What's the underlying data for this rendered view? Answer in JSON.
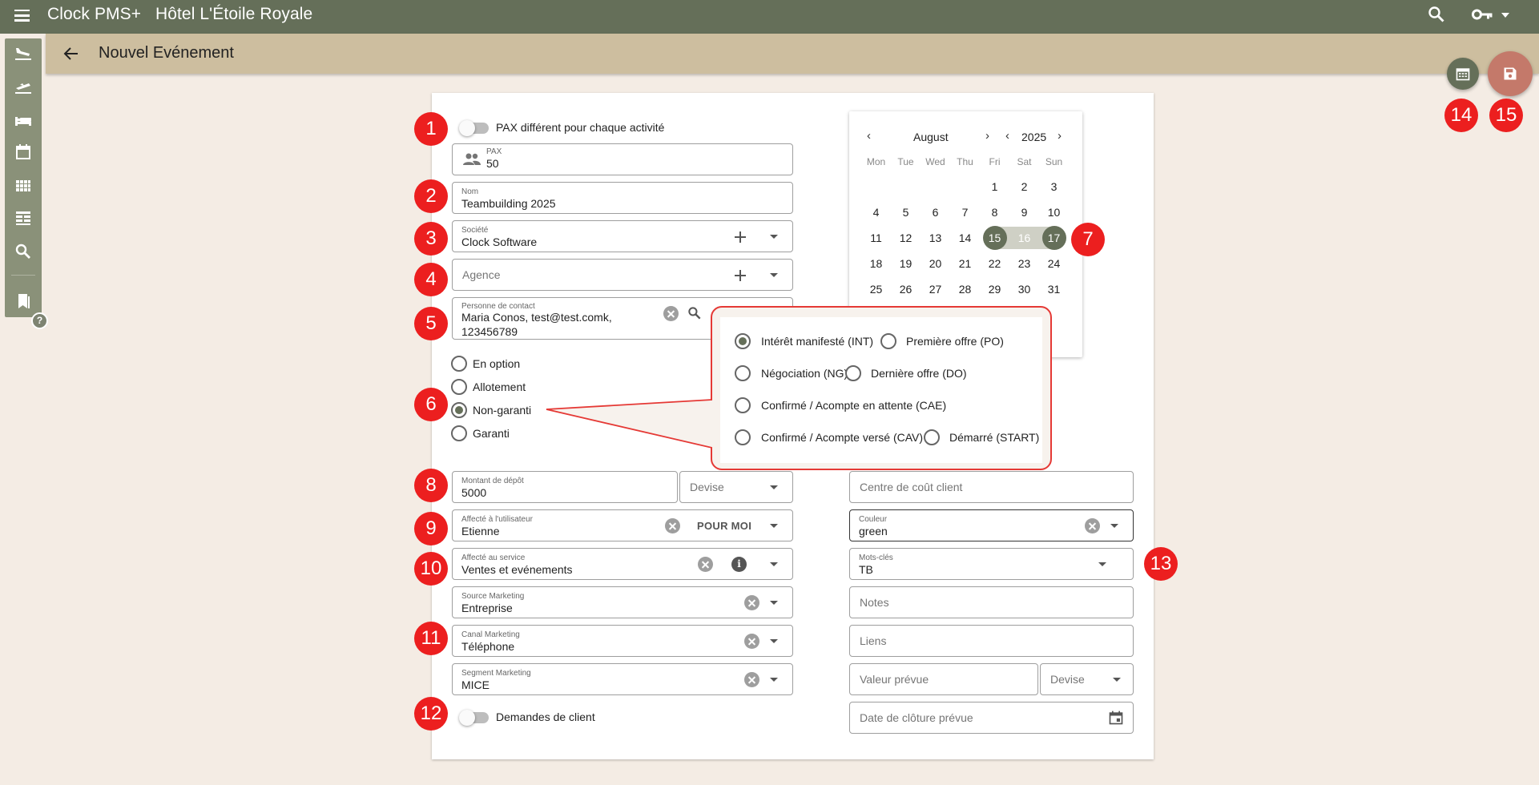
{
  "app": {
    "name": "Clock PMS+",
    "hotel": "Hôtel L'Étoile Royale"
  },
  "page": {
    "title": "Nouvel Evénement"
  },
  "toggles": {
    "pax_diff": "PAX différent pour chaque activité",
    "demandes": "Demandes de client"
  },
  "fields": {
    "pax": {
      "label": "PAX",
      "value": "50"
    },
    "nom": {
      "label": "Nom",
      "value": "Teambuilding 2025"
    },
    "societe": {
      "label": "Société",
      "value": "Clock Software"
    },
    "agence": {
      "placeholder": "Agence"
    },
    "contact": {
      "label": "Personne de contact",
      "line1": "Maria Conos, test@test.comk,",
      "line2": "123456789"
    },
    "depot": {
      "label": "Montant de dépôt",
      "value": "5000"
    },
    "devise": {
      "placeholder": "Devise"
    },
    "utilisateur": {
      "label": "Affecté à l'utilisateur",
      "value": "Etienne",
      "button": "POUR MOI"
    },
    "service": {
      "label": "Affecté au service",
      "value": "Ventes et evénements"
    },
    "source": {
      "label": "Source Marketing",
      "value": "Entreprise"
    },
    "canal": {
      "label": "Canal Marketing",
      "value": "Téléphone"
    },
    "segment": {
      "label": "Segment Marketing",
      "value": "MICE"
    },
    "centre_cout": {
      "placeholder": "Centre de coût client"
    },
    "couleur": {
      "label": "Couleur",
      "value": "green"
    },
    "mots_cles": {
      "label": "Mots-clés",
      "value": "TB"
    },
    "notes": {
      "placeholder": "Notes"
    },
    "liens": {
      "placeholder": "Liens"
    },
    "valeur": {
      "placeholder": "Valeur prévue"
    },
    "devise2": {
      "placeholder": "Devise"
    },
    "cloture": {
      "placeholder": "Date de clôture prévue"
    }
  },
  "status_options": [
    {
      "label": "En option",
      "selected": false
    },
    {
      "label": "Allotement",
      "selected": false
    },
    {
      "label": "Non-garanti",
      "selected": true
    },
    {
      "label": "Garanti",
      "selected": false
    }
  ],
  "stage_options": [
    {
      "label": "Intérêt manifesté (INT)",
      "selected": true
    },
    {
      "label": "Première offre (PO)",
      "selected": false
    },
    {
      "label": "Négociation (NG)",
      "selected": false
    },
    {
      "label": "Dernière offre (DO)",
      "selected": false
    },
    {
      "label": "Confirmé / Acompte en attente (CAE)",
      "selected": false
    },
    {
      "label": "Confirmé / Acompte versé (CAV)",
      "selected": false
    },
    {
      "label": "Démarré (START)",
      "selected": false
    }
  ],
  "calendar": {
    "month": "August",
    "year": "2025",
    "weekdays": [
      "Mon",
      "Tue",
      "Wed",
      "Thu",
      "Fri",
      "Sat",
      "Sun"
    ],
    "weeks": [
      [
        "",
        "",
        "",
        "",
        "1",
        "2",
        "3"
      ],
      [
        "4",
        "5",
        "6",
        "7",
        "8",
        "9",
        "10"
      ],
      [
        "11",
        "12",
        "13",
        "14",
        "15",
        "16",
        "17"
      ],
      [
        "18",
        "19",
        "20",
        "21",
        "22",
        "23",
        "24"
      ],
      [
        "25",
        "26",
        "27",
        "28",
        "29",
        "30",
        "31"
      ]
    ],
    "range_start": "15",
    "range_end": "17"
  },
  "markers": [
    "1",
    "2",
    "3",
    "4",
    "5",
    "6",
    "7",
    "8",
    "9",
    "10",
    "11",
    "12",
    "13",
    "14",
    "15"
  ],
  "colors": {
    "appbar": "#656f59",
    "subbar": "#cdbe9f",
    "accent": "#656f59",
    "save": "#c4796a",
    "marker": "#ec1f1f"
  }
}
